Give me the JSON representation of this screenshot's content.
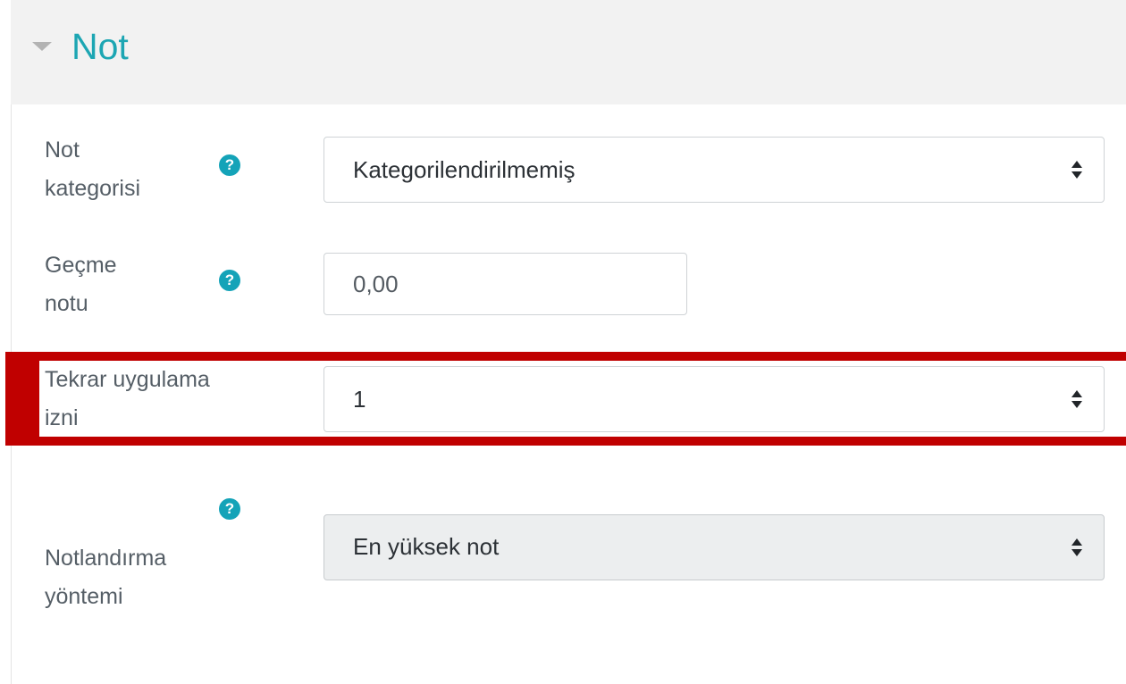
{
  "section": {
    "title": "Not",
    "toggle_icon": "caret-down-icon"
  },
  "fields": {
    "grade_category": {
      "label_line1": "Not",
      "label_line2": "kategorisi",
      "value": "Kategorilendirilmemiş"
    },
    "pass_grade": {
      "label_line1": "Geçme",
      "label_line2": "notu",
      "value": "0,00"
    },
    "attempts_allowed": {
      "label_line1": "Tekrar uygulama",
      "label_line2": "izni",
      "value": "1"
    },
    "grading_method": {
      "label_line1": "Notlandırma",
      "label_line2": "yöntemi",
      "value": "En yüksek not",
      "disabled": true
    }
  },
  "help_icon_glyph": "?",
  "colors": {
    "accent": "#1da6b3",
    "help_icon": "#14a3b8",
    "highlight": "#c00000",
    "header_bg": "#f2f2f2"
  }
}
